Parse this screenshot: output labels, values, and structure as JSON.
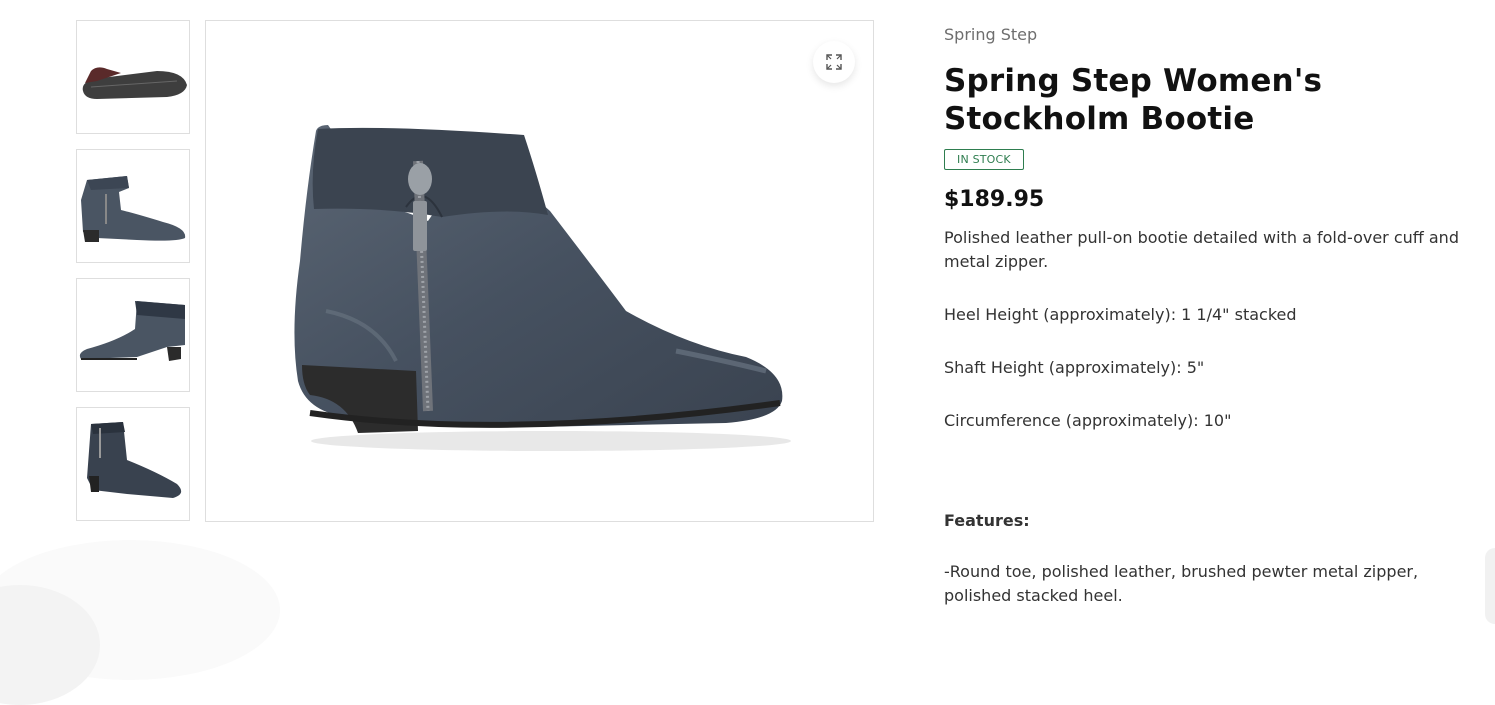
{
  "product": {
    "vendor": "Spring Step",
    "title": "Spring Step Women's Stockholm Bootie",
    "stock_badge": "IN STOCK",
    "price": "$189.95",
    "description": "Polished leather pull-on bootie detailed with a fold-over cuff and metal zipper.",
    "specs": [
      "Heel Height (approximately): 1 1/4\" stacked",
      "Shaft Height (approximately): 5\"",
      "Circumference (approximately): 10\""
    ],
    "features_heading": "Features:",
    "features_text": "-Round toe, polished leather, brushed pewter metal zipper, polished stacked heel."
  },
  "gallery": {
    "thumbnails": [
      {
        "icon": "boot-sole-view"
      },
      {
        "icon": "boot-side-view-inner"
      },
      {
        "icon": "boot-side-view-outer"
      },
      {
        "icon": "boot-angled-view"
      }
    ],
    "zoom_icon": "expand-icon"
  },
  "colors": {
    "boot": "#4a5563",
    "badge": "#2e7d4f",
    "border": "#dedede"
  }
}
